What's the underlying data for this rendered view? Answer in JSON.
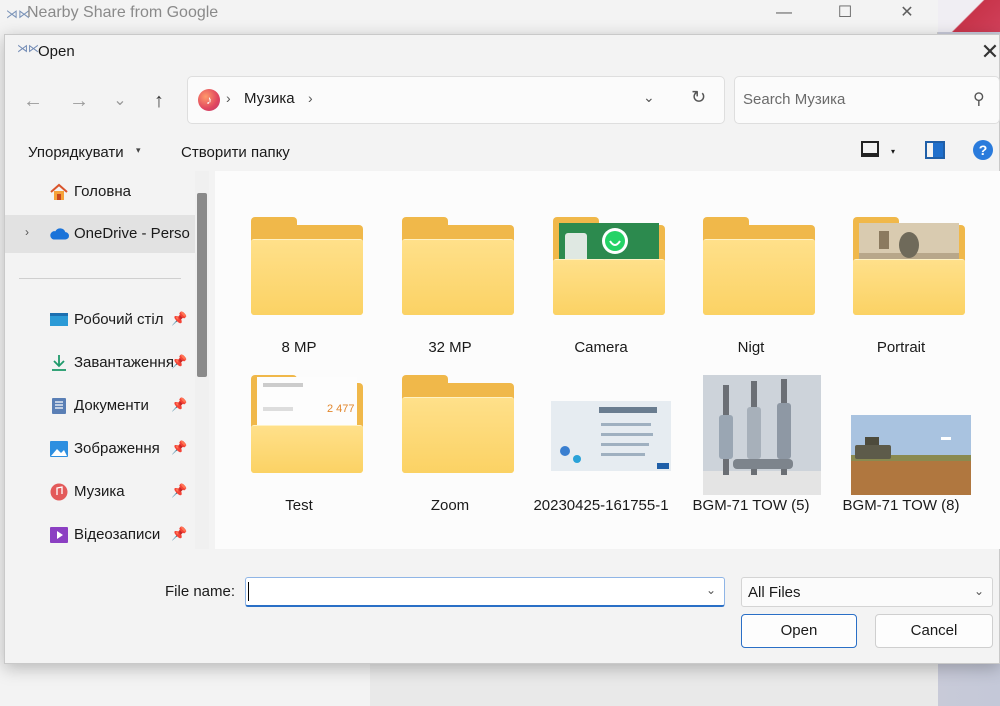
{
  "background_window": {
    "title": "Nearby Share from Google",
    "minimize_glyph": "—",
    "maximize_glyph": "☐",
    "close_glyph": "✕"
  },
  "dialog": {
    "title": "Open",
    "close_glyph": "✕"
  },
  "nav": {
    "back_glyph": "←",
    "forward_glyph": "→",
    "recent_glyph": "⌄",
    "up_glyph": "↑",
    "address": {
      "location_label": "Музика",
      "sep": "›",
      "dropdown_glyph": "⌄",
      "refresh_glyph": "↻"
    },
    "search": {
      "placeholder": "Search Музика",
      "icon_glyph": "⚲"
    }
  },
  "commands": {
    "organize_label": "Упорядкувати",
    "organize_caret": "▾",
    "new_folder_label": "Створити папку",
    "view_caret": "▾",
    "help_glyph": "?"
  },
  "sidebar": {
    "home_label": "Головна",
    "onedrive_label": "OneDrive - Perso",
    "expander_glyph": "›",
    "pin_glyph": "📌",
    "items": [
      {
        "label": "Робочий стіл"
      },
      {
        "label": "Завантаження"
      },
      {
        "label": "Документи"
      },
      {
        "label": "Зображення"
      },
      {
        "label": "Музика"
      },
      {
        "label": "Відеозаписи"
      }
    ]
  },
  "content": {
    "tiles": [
      {
        "label": "8 MP",
        "kind": "folder"
      },
      {
        "label": "32 MP",
        "kind": "folder"
      },
      {
        "label": "Camera",
        "kind": "folder-whatsapp"
      },
      {
        "label": "Nigt",
        "kind": "folder"
      },
      {
        "label": "Portrait",
        "kind": "folder-photo"
      },
      {
        "label": "Test",
        "kind": "folder-doc"
      },
      {
        "label": "Zoom",
        "kind": "folder"
      },
      {
        "label": "20230425-161755-1",
        "kind": "image-screenshot"
      },
      {
        "label": "BGM-71 TOW (5)",
        "kind": "image-missiles"
      },
      {
        "label": "BGM-71 TOW (8)",
        "kind": "image-landscape"
      }
    ],
    "test_folder_number": "2 477"
  },
  "bottom": {
    "file_name_label": "File name:",
    "file_name_value": "",
    "file_type_value": "All Files",
    "dropdown_glyph": "⌄",
    "open_label": "Open",
    "cancel_label": "Cancel"
  },
  "colors": {
    "accent": "#2a6fc6",
    "folder": "#fbd264",
    "folder_back": "#f0b84a"
  }
}
